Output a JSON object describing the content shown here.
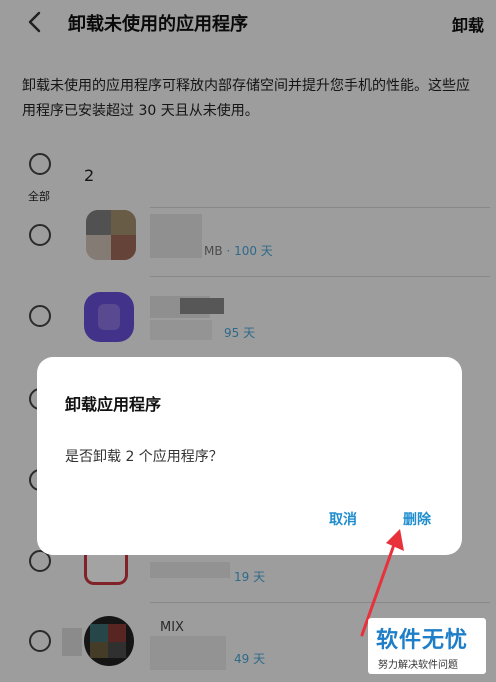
{
  "header": {
    "title": "卸载未使用的应用程序",
    "uninstall_label": "卸载"
  },
  "description": "卸载未使用的应用程序可释放内部存储空间并提升您手机的性能。这些应用程序已安装超过 30 天且从未使用。",
  "select_all": {
    "label": "全部",
    "selected_count": "2"
  },
  "apps": [
    {
      "name": "",
      "size": "MB",
      "days": "100 天"
    },
    {
      "name": "",
      "size": "",
      "days": "95 天"
    },
    {
      "name": "",
      "size": "",
      "days": ""
    },
    {
      "name": "",
      "size": "",
      "days": ""
    },
    {
      "name": "",
      "size": "",
      "days": "19 天"
    },
    {
      "name": "MIX",
      "size": "",
      "days": "49 天"
    }
  ],
  "dialog": {
    "title": "卸载应用程序",
    "message": "是否卸载 2 个应用程序？",
    "cancel_label": "取消",
    "delete_label": "删除"
  },
  "watermark": {
    "main": "软件无忧",
    "sub": "努力解决软件问题"
  },
  "colors": {
    "accent": "#1f8ecf",
    "meta": "#4aa7d6",
    "arrow": "#e8313b"
  }
}
